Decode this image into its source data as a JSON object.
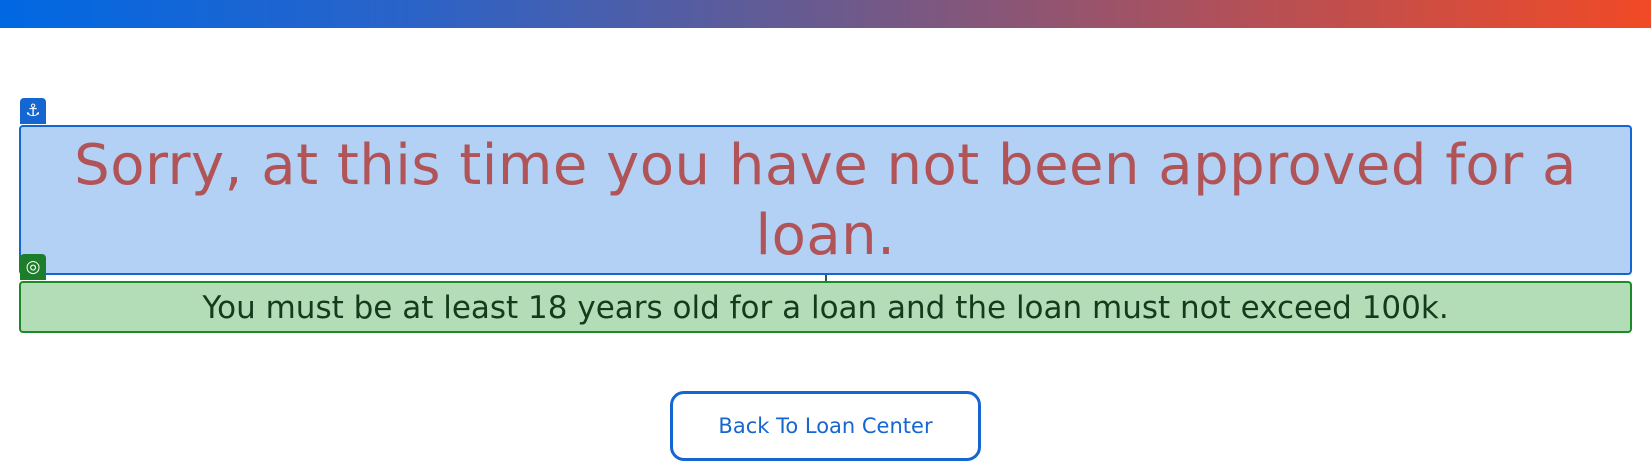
{
  "header": {
    "gradient_colors": [
      "#0068e3",
      "#f14a26"
    ]
  },
  "badges": {
    "anchor_icon": "⚓",
    "target_icon": "◎"
  },
  "message": {
    "headline": "Sorry, at this time you have not been approved for a loan.",
    "requirement": "You must be at least 18 years old for a loan and the loan must not exceed 100k."
  },
  "actions": {
    "back_label": "Back To Loan Center"
  },
  "colors": {
    "headline_text": "#b15458",
    "headline_bg": "#b3d1f4",
    "requirement_text": "#153b1c",
    "requirement_bg": "#b3ddb6",
    "accent": "#1666d2"
  }
}
